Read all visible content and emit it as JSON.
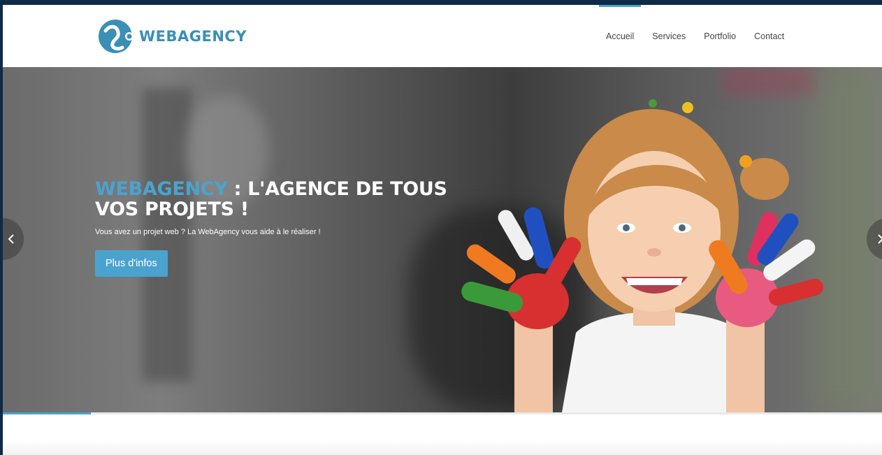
{
  "brand": {
    "name": "WEBAGENCY",
    "color": "#3a8fb5",
    "logo_icon": "webagency-logo-icon"
  },
  "nav": {
    "items": [
      {
        "label": "Accueil",
        "active": true
      },
      {
        "label": "Services",
        "active": false
      },
      {
        "label": "Portfolio",
        "active": false
      },
      {
        "label": "Contact",
        "active": false
      }
    ]
  },
  "hero": {
    "title_accent": "WEBAGENCY",
    "title_rest": " : L'AGENCE DE TOUS VOS PROJETS !",
    "subtitle": "Vous avez un projet web ? La WebAgency vous aide à le réaliser !",
    "button_label": "Plus d'infos",
    "accent_color": "#4aa3cf",
    "prev_icon": "chevron-left-icon",
    "next_icon": "chevron-right-icon",
    "progress": 0.1
  }
}
